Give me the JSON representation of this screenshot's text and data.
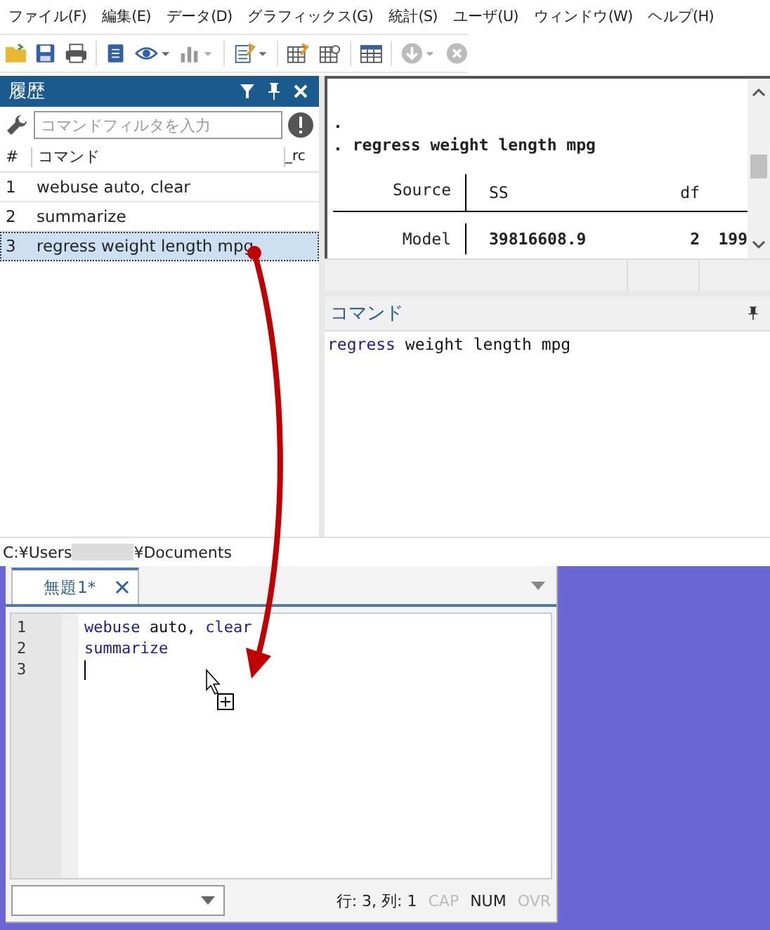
{
  "menu": [
    "ファイル(F)",
    "編集(E)",
    "データ(D)",
    "グラフィックス(G)",
    "統計(S)",
    "ユーザ(U)",
    "ウィンドウ(W)",
    "ヘルプ(H)"
  ],
  "history": {
    "title": "履歴",
    "filter": {
      "placeholder": "コマンドフィルタを入力"
    },
    "columns": [
      "#",
      "コマンド",
      "_rc"
    ],
    "rows": [
      {
        "number": "1",
        "command": "webuse auto, clear",
        "selected": false
      },
      {
        "number": "2",
        "command": "summarize",
        "selected": false
      },
      {
        "number": "3",
        "command": "regress weight length mpg",
        "selected": true
      }
    ]
  },
  "results": {
    "lines": [
      ".",
      ". regress weight length mpg"
    ],
    "table": {
      "header": [
        "Source",
        "SS",
        "df"
      ],
      "rows": [
        [
          "Model",
          "39816608.9",
          "2",
          "199"
        ]
      ]
    }
  },
  "command": {
    "title": "コマンド",
    "tokens": [
      {
        "text": "regress",
        "kind": "keyword"
      },
      {
        "text": " weight length mpg",
        "kind": "plain"
      }
    ]
  },
  "path": {
    "prefix": "C:¥Users",
    "suffix": "¥Documents"
  },
  "editor": {
    "tabs": [
      {
        "label": "無題1*",
        "selected": true
      }
    ],
    "lines": [
      {
        "number": "1",
        "cursor": false,
        "tokens": [
          {
            "text": "webuse",
            "kind": "keyword"
          },
          {
            "text": " auto, ",
            "kind": "plain"
          },
          {
            "text": "clear",
            "kind": "keyword"
          }
        ]
      },
      {
        "number": "2",
        "cursor": false,
        "tokens": [
          {
            "text": "summarize",
            "kind": "keyword"
          }
        ]
      },
      {
        "number": "3",
        "cursor": true
      }
    ],
    "status": {
      "position": "行: 3, 列: 1",
      "indicators": [
        {
          "label": "CAP",
          "on": false
        },
        {
          "label": "NUM",
          "on": true
        },
        {
          "label": "OVR",
          "on": false
        }
      ]
    }
  }
}
